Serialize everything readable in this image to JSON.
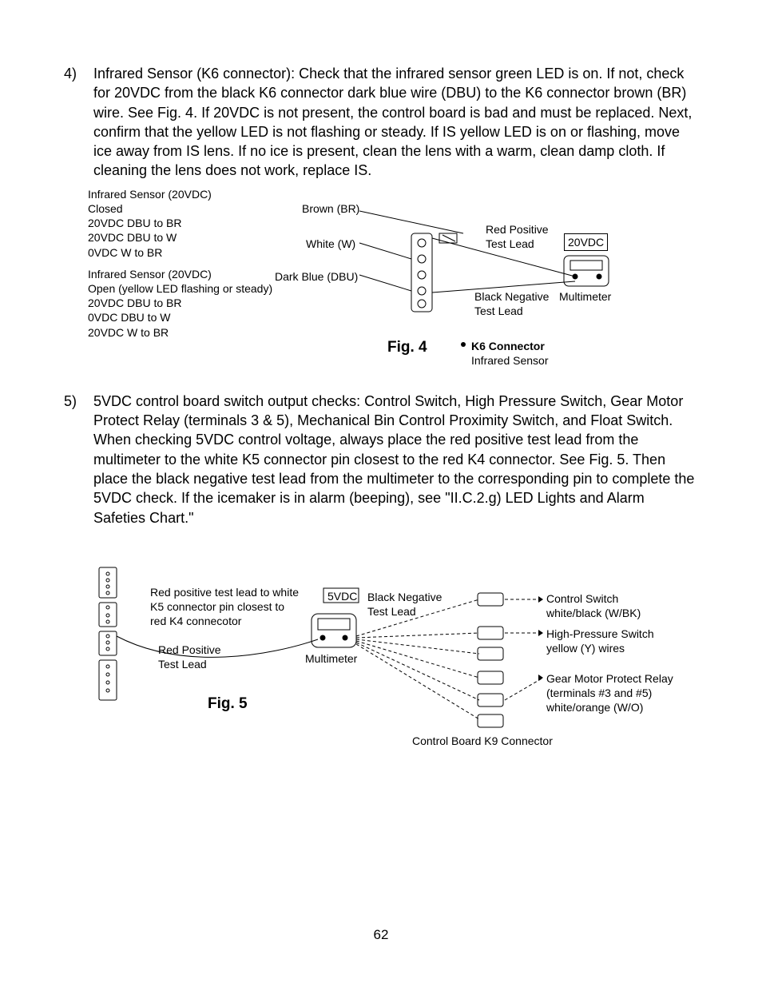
{
  "step4": {
    "num": "4)",
    "text": "Infrared Sensor (K6 connector): Check that the infrared sensor green LED is on. If not, check for 20VDC from the black K6 connector dark blue wire (DBU) to the K6 connector brown (BR) wire. See Fig. 4. If 20VDC is not present, the control board is bad and must be replaced. Next, confirm that the yellow LED is not flashing or steady. If IS yellow LED is on or flashing, move ice away from IS lens. If no ice is present, clean the lens with a warm, clean damp cloth. If cleaning the lens does not work, replace IS."
  },
  "fig4": {
    "label": "Fig. 4",
    "left_block1_l1": "Infrared Sensor (20VDC)",
    "left_block1_l2": "Closed",
    "left_block1_l3": "20VDC DBU to BR",
    "left_block1_l4": "20VDC DBU to W",
    "left_block1_l5": "0VDC W to BR",
    "left_block2_l1": "Infrared Sensor (20VDC)",
    "left_block2_l2": "Open (yellow LED flashing or steady)",
    "left_block2_l3": "20VDC DBU to BR",
    "left_block2_l4": "0VDC DBU to W",
    "left_block2_l5": "20VDC W to BR",
    "wire_br": "Brown (BR)",
    "wire_w": "White (W)",
    "wire_dbu": "Dark Blue (DBU)",
    "red_lead": "Red Positive",
    "red_lead2": "Test Lead",
    "voltage": "20VDC",
    "black_lead": "Black Negative",
    "black_lead2": "Test Lead",
    "multimeter": "Multimeter",
    "k6_l1": "K6 Connector",
    "k6_l2": "Infrared Sensor"
  },
  "step5": {
    "num": "5)",
    "text1": "5VDC control board switch output checks: Control Switch, High Pressure Switch, Gear Motor Protect Relay (terminals 3 & 5), Mechanical Bin Control Proximity Switch, and Float Switch.",
    "text2": "When checking 5VDC control voltage, always place the red positive test lead from the multimeter to the white K5 connector pin closest to the red K4 connector. See Fig. 5. Then place the black negative test lead from the multimeter to the corresponding pin to complete the 5VDC check. If the icemaker is in alarm (beeping), see \"II.C.2.g) LED Lights and Alarm Safeties Chart.\""
  },
  "fig5": {
    "label": "Fig. 5",
    "note1_l1": "Red positive test lead to white",
    "note1_l2": "K5 connector pin closest to",
    "note1_l3": "red K4 connecotor",
    "red_lead": "Red Positive",
    "red_lead2": "Test Lead",
    "voltage": "5VDC",
    "black_lead": "Black Negative",
    "black_lead2": "Test Lead",
    "multimeter": "Multimeter",
    "ctrl_sw_l1": "Control Switch",
    "ctrl_sw_l2": "white/black (W/BK)",
    "hp_sw_l1": "High-Pressure Switch",
    "hp_sw_l2": "yellow (Y) wires",
    "gm_l1": "Gear Motor Protect Relay",
    "gm_l2": "(terminals #3 and #5)",
    "gm_l3": "white/orange (W/O)",
    "k9": "Control Board K9 Connector"
  },
  "page_number": "62"
}
